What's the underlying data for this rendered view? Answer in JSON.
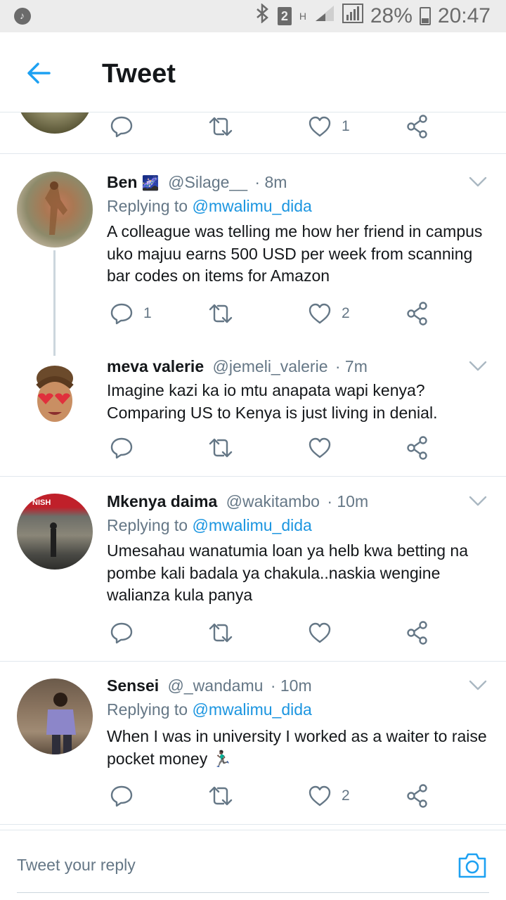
{
  "status_bar": {
    "sim_slot": "2",
    "hsig": "H",
    "battery": "28%",
    "time": "20:47"
  },
  "header": {
    "title": "Tweet"
  },
  "partial_tweet": {
    "like_count": "1"
  },
  "tweets": [
    {
      "name": "Ben",
      "name_emoji": "🌌",
      "handle": "@Silage__",
      "time": "· 8m",
      "replying_label": "Replying to",
      "replying_to": "@mwalimu_dida",
      "text": "A colleague was telling me how her friend in campus uko majuu earns 500 USD per week from scanning bar codes on items for Amazon",
      "reply_count": "1",
      "retweet_count": "",
      "like_count": "2"
    },
    {
      "name": "meva valerie",
      "handle": "@jemeli_valerie",
      "time": "· 7m",
      "text": "Imagine kazi ka io mtu anapata wapi kenya? Comparing US to Kenya is just living in denial.",
      "reply_count": "",
      "retweet_count": "",
      "like_count": ""
    },
    {
      "name": "Mkenya daima",
      "handle": "@wakitambo",
      "time": "· 10m",
      "replying_label": "Replying to",
      "replying_to": "@mwalimu_dida",
      "text": "Umesahau wanatumia loan ya helb kwa betting na pombe kali badala ya chakula..naskia wengine walianza kula panya",
      "reply_count": "",
      "retweet_count": "",
      "like_count": ""
    },
    {
      "name": "Sensei",
      "handle": "@_wandamu",
      "time": "· 10m",
      "replying_label": "Replying to",
      "replying_to": "@mwalimu_dida",
      "text": "When I was in university I worked as a waiter to raise pocket money 🏃🏿‍♂️",
      "reply_count": "",
      "retweet_count": "",
      "like_count": "2"
    }
  ],
  "reply_bar": {
    "placeholder": "Tweet your reply"
  },
  "colors": {
    "accent": "#1da1f2",
    "link": "#1b95e0",
    "muted": "#657786",
    "divider": "#e1e8ed"
  },
  "icons": [
    "music-note-icon",
    "bluetooth-icon",
    "signal-icon",
    "battery-icon",
    "back-arrow-icon",
    "reply-icon",
    "retweet-icon",
    "like-icon",
    "share-icon",
    "chevron-down-icon",
    "camera-icon"
  ]
}
